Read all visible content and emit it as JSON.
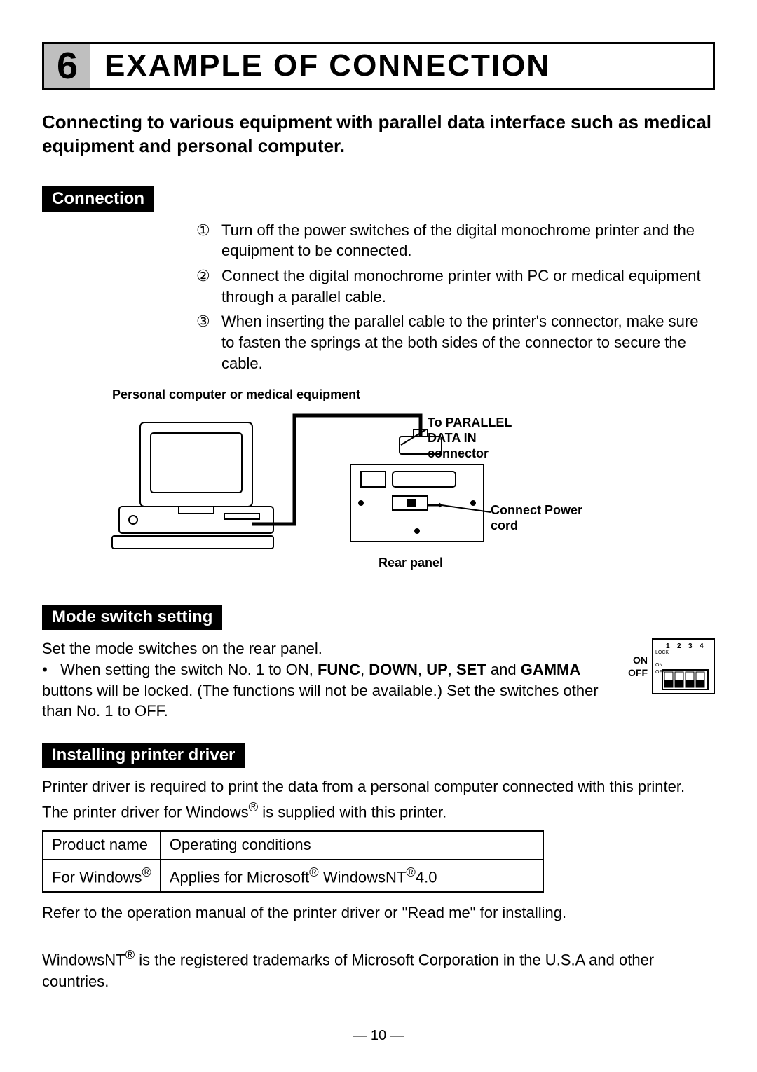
{
  "header": {
    "number": "6",
    "title": "EXAMPLE OF CONNECTION"
  },
  "intro": "Connecting to various equipment with parallel data interface such as medical equipment and personal computer.",
  "sections": {
    "connection": {
      "heading": "Connection",
      "steps": [
        "Turn off the power switches of the digital monochrome printer and the equipment to be connected.",
        "Connect the digital monochrome printer with PC or medical equipment through a parallel cable.",
        "When inserting the parallel cable to the printer's connector, make sure to fasten the springs at the both sides of the connector to secure the cable."
      ]
    },
    "mode": {
      "heading": "Mode switch setting",
      "line1": "Set the mode switches on the rear panel.",
      "bullet_prefix": "When setting the switch No. 1 to ON, ",
      "bold_words": [
        "FUNC",
        "DOWN",
        "UP",
        "SET",
        "GAMMA"
      ],
      "bullet_mid": " buttons will be locked. (The functions will not be available.) Set the switches other than No. 1 to OFF.",
      "dip": {
        "on": "ON",
        "off": "OFF",
        "cols": [
          "1",
          "2",
          "3",
          "4"
        ],
        "rows": [
          "LOCK",
          "",
          "ON",
          "OFF"
        ]
      }
    },
    "driver": {
      "heading": "Installing printer driver",
      "p1": "Printer driver is required to print the data from a personal computer connected with this printer.",
      "p2_pre": "The printer driver for Windows",
      "p2_post": " is supplied with this printer.",
      "table": {
        "h1": "Product name",
        "h2": "Operating conditions",
        "r1c1_pre": "For Windows",
        "r1c2_pre": "Applies for Microsoft",
        "r1c2_mid": " WindowsNT",
        "r1c2_post": "4.0"
      },
      "p3": "Refer to the operation manual of the printer driver or \"Read me\" for installing.",
      "p4_pre": "WindowsNT",
      "p4_post": " is the registered trademarks of Microsoft Corporation in the U.S.A and other countries."
    }
  },
  "diagram": {
    "pc_label": "Personal computer or medical equipment",
    "parallel_label": "To PARALLEL DATA IN connector",
    "power_label": "Connect Power cord",
    "rear_label": "Rear panel"
  },
  "page_number": "10"
}
